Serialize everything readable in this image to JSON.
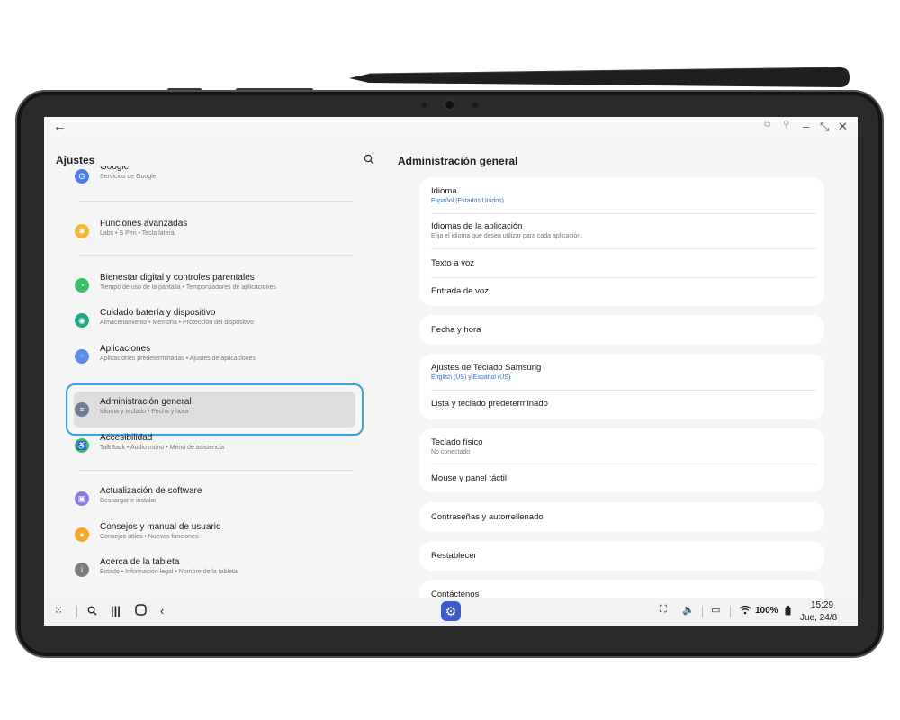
{
  "left_pane": {
    "title": "Ajustes",
    "items": [
      {
        "title": "Google",
        "subtitle": "Servicios de Google",
        "icon": "google-icon",
        "color": "#4a7df0"
      },
      {
        "title": "Funciones avanzadas",
        "subtitle": "Labs  •  S Pen  •  Tecla lateral",
        "icon": "advanced-features-icon",
        "color": "#f5b731"
      },
      {
        "title": "Bienestar digital y controles parentales",
        "subtitle": "Tiempo de uso de la pantalla  •  Temporizadores de aplicaciones",
        "icon": "digital-wellbeing-icon",
        "color": "#3bbf6a"
      },
      {
        "title": "Cuidado batería y dispositivo",
        "subtitle": "Almacenamiento  •  Memoria  •  Protección del dispositivo",
        "icon": "device-care-icon",
        "color": "#1fa888"
      },
      {
        "title": "Aplicaciones",
        "subtitle": "Aplicaciones predeterminadas  •  Ajustes de aplicaciones",
        "icon": "apps-icon",
        "color": "#5b8fe8"
      },
      {
        "title": "Administración general",
        "subtitle": "Idioma y teclado  •  Fecha y hora",
        "icon": "general-management-icon",
        "color": "#6d7d93"
      },
      {
        "title": "Accesibilidad",
        "subtitle": "TalkBack  •  Audio mono  •  Menú de asistencia",
        "icon": "accessibility-icon",
        "color": "#3bbf6a"
      },
      {
        "title": "Actualización de software",
        "subtitle": "Descargar e instalar",
        "icon": "software-update-icon",
        "color": "#8a7be8"
      },
      {
        "title": "Consejos y manual de usuario",
        "subtitle": "Consejos útiles  •  Nuevas funciones",
        "icon": "tips-icon",
        "color": "#f5a623"
      },
      {
        "title": "Acerca de la tableta",
        "subtitle": "Estado  •  Información legal  •  Nombre de la tableta",
        "icon": "about-tablet-icon",
        "color": "#7d7d7d"
      }
    ]
  },
  "right_pane": {
    "title": "Administración general",
    "cards": [
      {
        "rows": [
          {
            "title": "Idioma",
            "subtitle": "Español (Estados Unidos)",
            "subtitle_color": "#2f6fd6"
          },
          {
            "title": "Idiomas de la aplicación",
            "subtitle": "Elija el idioma que desea utilizar para cada aplicación."
          },
          {
            "title": "Texto a voz"
          },
          {
            "title": "Entrada de voz"
          }
        ]
      },
      {
        "rows": [
          {
            "title": "Fecha y hora"
          }
        ]
      },
      {
        "rows": [
          {
            "title": "Ajustes de Teclado Samsung",
            "subtitle": "English (US) y Español (US)",
            "subtitle_color": "#2f6fd6"
          },
          {
            "title": "Lista y teclado predeterminado"
          }
        ]
      },
      {
        "rows": [
          {
            "title": "Teclado físico",
            "subtitle": "No conectado"
          },
          {
            "title": "Mouse y panel táctil"
          }
        ]
      },
      {
        "rows": [
          {
            "title": "Contraseñas y autorrellenado"
          }
        ]
      },
      {
        "rows": [
          {
            "title": "Restablecer"
          }
        ]
      },
      {
        "rows": [
          {
            "title": "Contáctenos"
          }
        ]
      }
    ]
  },
  "taskbar": {
    "battery": "100%",
    "time": "15:29",
    "date": "Jue, 24/8"
  }
}
